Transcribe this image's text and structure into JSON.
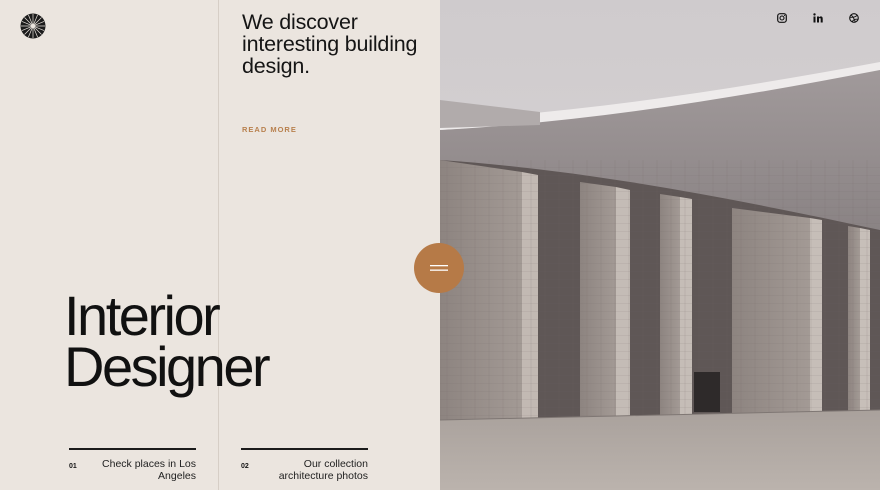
{
  "header": {
    "logo_icon": "sunburst-logo-icon",
    "social": [
      {
        "name": "instagram",
        "icon": "instagram-icon"
      },
      {
        "name": "linkedin",
        "icon": "linkedin-icon"
      },
      {
        "name": "dribbble",
        "icon": "dribbble-icon"
      }
    ]
  },
  "intro": {
    "tagline": "We discover interesting building design.",
    "read_more_label": "READ MORE"
  },
  "hero": {
    "title_line1": "Interior",
    "title_line2": "Designer"
  },
  "features": [
    {
      "number": "01",
      "text": "Check places in Los Angeles"
    },
    {
      "number": "02",
      "text": "Our collection architecture photos"
    }
  ],
  "menu": {
    "icon": "hamburger-icon"
  },
  "colors": {
    "background": "#ebe5df",
    "accent": "#b67a47",
    "text": "#141414"
  }
}
